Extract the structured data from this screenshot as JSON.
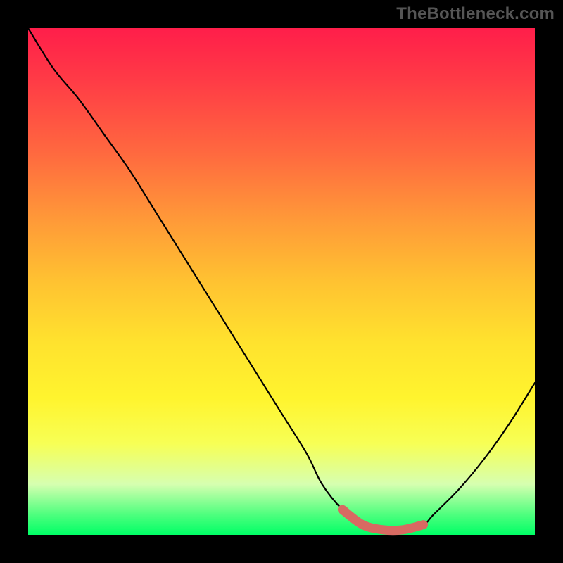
{
  "watermark": "TheBottleneck.com",
  "chart_data": {
    "type": "line",
    "title": "",
    "xlabel": "",
    "ylabel": "",
    "xlim": [
      0,
      100
    ],
    "ylim": [
      0,
      100
    ],
    "grid": false,
    "legend": false,
    "series": [
      {
        "name": "bottleneck-curve",
        "x": [
          0,
          5,
          10,
          15,
          20,
          25,
          30,
          35,
          40,
          45,
          50,
          55,
          58,
          62,
          66,
          70,
          74,
          78,
          80,
          85,
          90,
          95,
          100
        ],
        "y": [
          100,
          92,
          86,
          79,
          72,
          64,
          56,
          48,
          40,
          32,
          24,
          16,
          10,
          5,
          2,
          1,
          1,
          2,
          4,
          9,
          15,
          22,
          30
        ],
        "stroke": "#000000"
      },
      {
        "name": "optimal-range-highlight",
        "x": [
          62,
          66,
          70,
          74,
          78
        ],
        "y": [
          5,
          2,
          1,
          1,
          2
        ],
        "stroke": "#d86a62"
      }
    ],
    "annotations": []
  }
}
